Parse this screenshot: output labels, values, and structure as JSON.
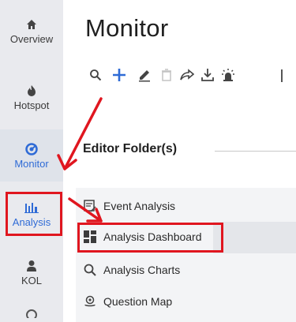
{
  "sidebar": {
    "items": [
      {
        "label": "Overview",
        "icon": "home-icon"
      },
      {
        "label": "Hotspot",
        "icon": "flame-icon"
      },
      {
        "label": "Monitor",
        "icon": "monitor-icon"
      },
      {
        "label": "Analysis",
        "icon": "bar-chart-icon"
      },
      {
        "label": "KOL",
        "icon": "person-icon"
      }
    ]
  },
  "main": {
    "title": "Monitor",
    "toolbar": [
      "search-icon",
      "plus-icon",
      "edit-icon",
      "trash-icon",
      "share-icon",
      "download-icon",
      "alarm-icon"
    ],
    "folder_title": "Editor Folder(s)"
  },
  "menu": {
    "items": [
      {
        "label": "Event Analysis",
        "icon": "event-icon"
      },
      {
        "label": "Analysis Dashboard",
        "icon": "dashboard-icon"
      },
      {
        "label": "Analysis Charts",
        "icon": "search-icon"
      },
      {
        "label": "Question Map",
        "icon": "map-pin-icon"
      }
    ]
  },
  "colors": {
    "accent": "#2f6bd6",
    "sidebar_bg": "#e9eaee",
    "annotation": "#e0161f"
  }
}
